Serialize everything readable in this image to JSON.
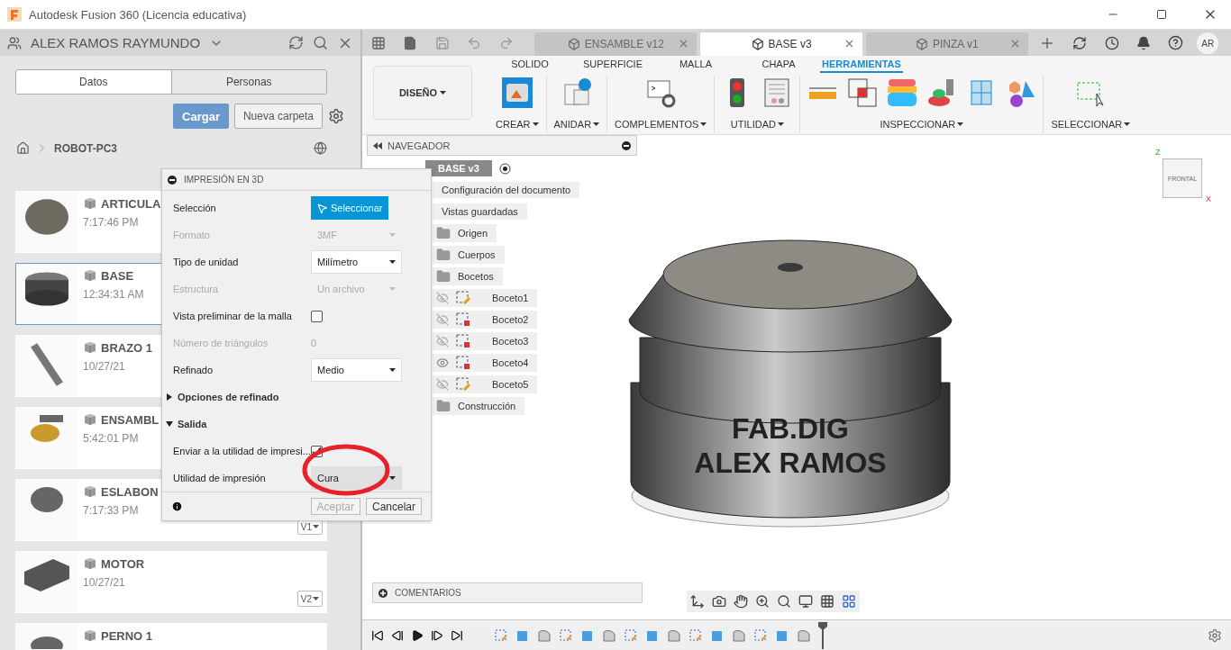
{
  "window": {
    "title": "Autodesk Fusion 360 (Licencia educativa)"
  },
  "data_panel": {
    "user": "ALEX RAMOS RAYMUNDO",
    "tabs": [
      {
        "label": "Datos",
        "selected": true
      },
      {
        "label": "Personas",
        "selected": false
      }
    ],
    "upload_button": "Cargar",
    "new_folder_button": "Nueva carpeta",
    "breadcrumb": "ROBOT-PC3",
    "files": [
      {
        "name": "ARTICULA",
        "time": "7:17:46 PM",
        "selected": false
      },
      {
        "name": "BASE",
        "time": "12:34:31 AM",
        "selected": true
      },
      {
        "name": "BRAZO 1",
        "time": "10/27/21",
        "selected": false
      },
      {
        "name": "ENSAMBL",
        "time": "5:42:01 PM",
        "selected": false
      },
      {
        "name": "ESLABON",
        "time": "7:17:33 PM",
        "version": "V1",
        "selected": false
      },
      {
        "name": "MOTOR",
        "time": "10/27/21",
        "version": "V2",
        "selected": false
      },
      {
        "name": "PERNO 1",
        "selected": false
      }
    ]
  },
  "document_tabs": [
    {
      "label": "ENSAMBLE v12",
      "selected": false
    },
    {
      "label": "BASE v3",
      "selected": true
    },
    {
      "label": "PINZA v1",
      "selected": false
    }
  ],
  "avatar": "AR",
  "ribbon": {
    "workspace": "DISEÑO",
    "tabs": [
      {
        "label": "SOLIDO",
        "selected": false
      },
      {
        "label": "SUPERFICIE",
        "selected": false
      },
      {
        "label": "MALLA",
        "selected": false
      },
      {
        "label": "CHAPA",
        "selected": false
      },
      {
        "label": "HERRAMIENTAS",
        "selected": true
      }
    ],
    "groups": [
      "CREAR",
      "ANIDAR",
      "COMPLEMENTOS",
      "UTILIDAD",
      "INSPECCIONAR",
      "SELECCIONAR"
    ]
  },
  "navigator": {
    "title": "NAVEGADOR",
    "root": {
      "label": "BASE v3",
      "children": [
        {
          "kind": "doc",
          "label": "Configuración del documento"
        },
        {
          "kind": "doc",
          "label": "Vistas guardadas"
        },
        {
          "kind": "folder",
          "label": "Origen"
        },
        {
          "kind": "folder",
          "label": "Cuerpos"
        },
        {
          "kind": "folder",
          "label": "Bocetos",
          "children": [
            {
              "kind": "sketch",
              "label": "Boceto1",
              "visible": false,
              "locked": false
            },
            {
              "kind": "sketch",
              "label": "Boceto2",
              "visible": false,
              "locked": true
            },
            {
              "kind": "sketch",
              "label": "Boceto3",
              "visible": false,
              "locked": true
            },
            {
              "kind": "sketch",
              "label": "Boceto4",
              "visible": true,
              "locked": true
            },
            {
              "kind": "sketch",
              "label": "Boceto5",
              "visible": false,
              "locked": false
            }
          ]
        },
        {
          "kind": "folder",
          "label": "Construcción"
        }
      ]
    }
  },
  "dialog": {
    "title": "IMPRESIÓN EN 3D",
    "rows": [
      {
        "kind": "button",
        "label": "Selección",
        "value": "Seleccionar",
        "disabled": false
      },
      {
        "kind": "select",
        "label": "Formato",
        "value": "3MF",
        "disabled": true
      },
      {
        "kind": "select",
        "label": "Tipo de unidad",
        "value": "Milímetro",
        "disabled": false
      },
      {
        "kind": "select",
        "label": "Estructura",
        "value": "Un archivo",
        "disabled": true
      },
      {
        "kind": "checkbox",
        "label": "Vista preliminar de la malla",
        "checked": false,
        "disabled": false
      },
      {
        "kind": "value",
        "label": "Número de triángulos",
        "value": "0",
        "disabled": true
      },
      {
        "kind": "select",
        "label": "Refinado",
        "value": "Medio",
        "disabled": false
      },
      {
        "kind": "section",
        "label": "Opciones de refinado",
        "expanded": false
      },
      {
        "kind": "section",
        "label": "Salida",
        "expanded": true
      },
      {
        "kind": "checkbox",
        "label": "Enviar a la utilidad de impresi...",
        "checked": true,
        "disabled": false
      },
      {
        "kind": "utility",
        "label": "Utilidad de impresión",
        "value": "Cura",
        "disabled": false
      }
    ],
    "ok_button": {
      "label": "Aceptar",
      "disabled": true
    },
    "cancel_button": "Cancelar"
  },
  "annotation": {
    "kind": "ellipse",
    "color": "#e8202a"
  },
  "viewport": {
    "engraving": [
      "FAB.DIG",
      "ALEX RAMOS"
    ],
    "viewcube": {
      "face": "FRONTAL",
      "axis_up": "Z",
      "axis_right": "X"
    },
    "comments": "COMENTARIOS"
  }
}
